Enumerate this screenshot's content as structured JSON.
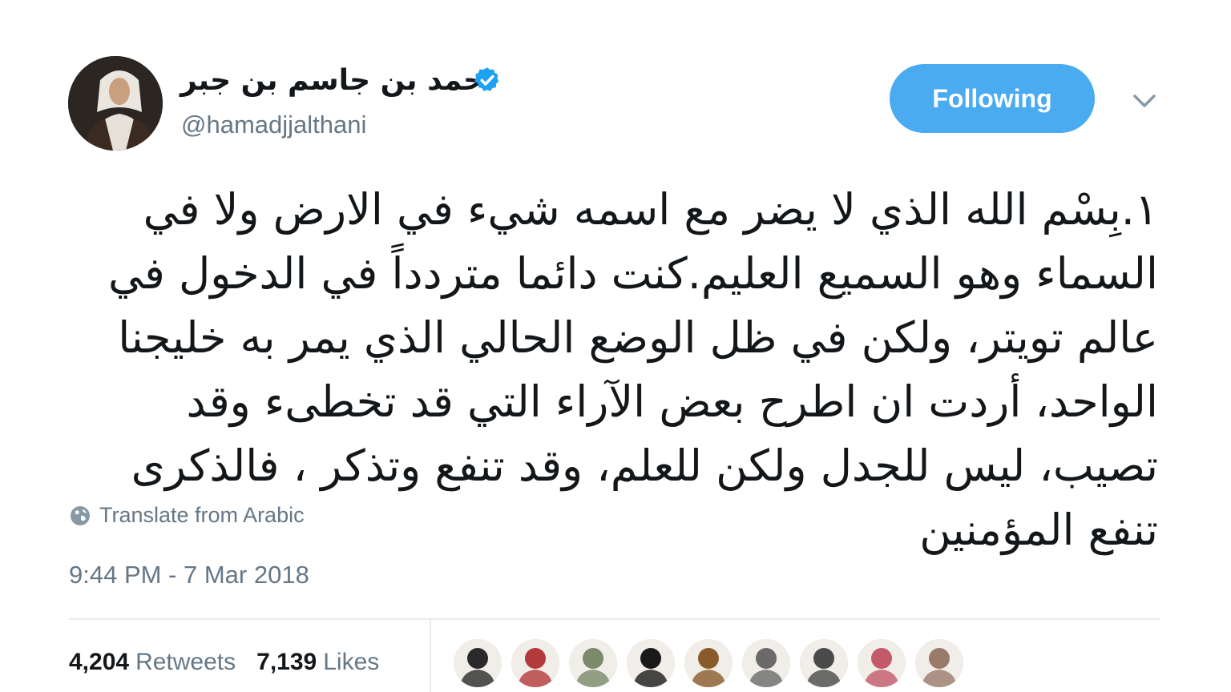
{
  "user": {
    "display_name": "حمد بن جاسم بن جبر",
    "handle": "@hamadjjalthani",
    "verified_color": "#1da1f2"
  },
  "follow_button": {
    "label": "Following",
    "color": "#4aabf0"
  },
  "tweet": {
    "text": "١.بِسْم الله الذي لا يضر مع اسمه شيء في الارض ولا في السماء وهو السميع العليم.كنت دائما متردداً في الدخول في عالم تويتر، ولكن في ظل الوضع الحالي الذي يمر به خليجنا الواحد، أردت ان اطرح بعض الآراء التي قد تخطىء وقد تصيب، ليس للجدل ولكن للعلم، وقد تنفع وتذكر ، فالذكرى تنفع المؤمنين",
    "translate_label": "Translate from Arabic",
    "timestamp": "9:44 PM - 7 Mar 2018"
  },
  "stats": {
    "retweets_count": "4,204",
    "retweets_label": "Retweets",
    "likes_count": "7,139",
    "likes_label": "Likes"
  },
  "liker_avatars": [
    {
      "icon": "liker-avatar-icon",
      "color": "#2a2a2a"
    },
    {
      "icon": "liker-avatar-icon",
      "color": "#b33a3a"
    },
    {
      "icon": "liker-avatar-icon",
      "color": "#7a8a6a"
    },
    {
      "icon": "liker-avatar-icon",
      "color": "#1a1a1a"
    },
    {
      "icon": "liker-avatar-icon",
      "color": "#8a5a2a"
    },
    {
      "icon": "liker-avatar-icon",
      "color": "#6a6a6a"
    },
    {
      "icon": "liker-avatar-icon",
      "color": "#4a4a4a"
    },
    {
      "icon": "liker-avatar-icon",
      "color": "#c25a6a"
    },
    {
      "icon": "liker-avatar-icon",
      "color": "#9a7a6a"
    }
  ]
}
